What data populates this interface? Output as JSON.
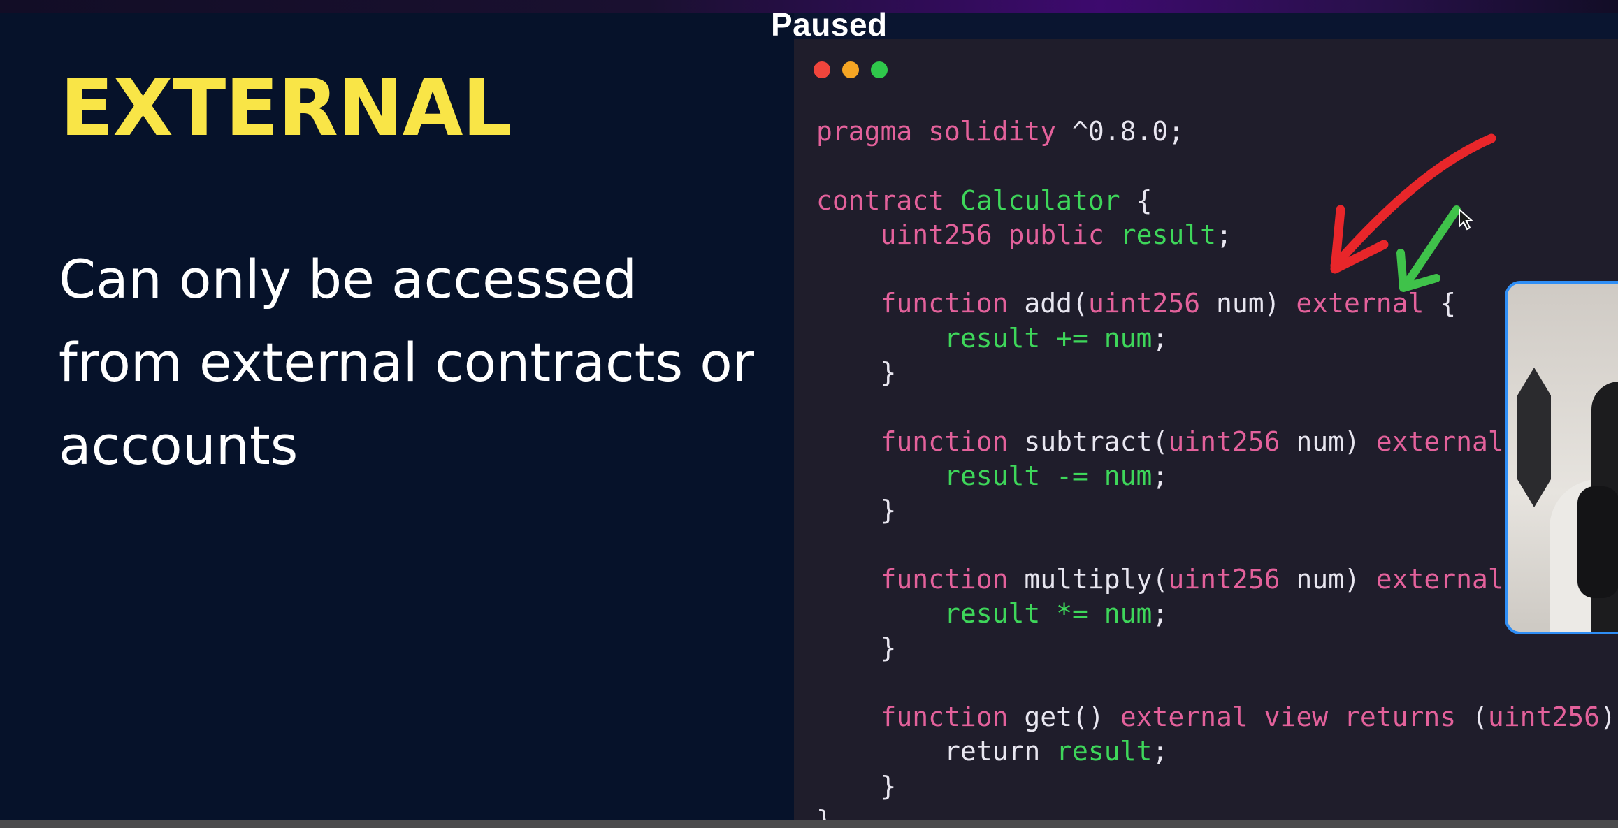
{
  "player": {
    "status": "Paused"
  },
  "slide": {
    "heading": "EXTERNAL",
    "description": "Can only be accessed from external contracts or accounts"
  },
  "code": {
    "lines": [
      [
        [
          "pragma solidity ",
          "kw"
        ],
        [
          "^0.8.0;",
          "pl"
        ]
      ],
      [],
      [
        [
          "contract ",
          "kw"
        ],
        [
          "Calculator",
          "gr"
        ],
        [
          " {",
          "pl"
        ]
      ],
      [
        [
          "    uint256 public ",
          "kw"
        ],
        [
          "result",
          "gr"
        ],
        [
          ";",
          "pl"
        ]
      ],
      [],
      [
        [
          "    function ",
          "kw"
        ],
        [
          "add(",
          "fn"
        ],
        [
          "uint256",
          "kw"
        ],
        [
          " num) ",
          "fn"
        ],
        [
          "external",
          "kw"
        ],
        [
          " {",
          "pl"
        ]
      ],
      [
        [
          "        result += num",
          "gr"
        ],
        [
          ";",
          "pl"
        ]
      ],
      [
        [
          "    }",
          "pl"
        ]
      ],
      [],
      [
        [
          "    function ",
          "kw"
        ],
        [
          "subtract(",
          "fn"
        ],
        [
          "uint256",
          "kw"
        ],
        [
          " num) ",
          "fn"
        ],
        [
          "external",
          "kw"
        ]
      ],
      [
        [
          "        result -= num",
          "gr"
        ],
        [
          ";",
          "pl"
        ]
      ],
      [
        [
          "    }",
          "pl"
        ]
      ],
      [],
      [
        [
          "    function ",
          "kw"
        ],
        [
          "multiply(",
          "fn"
        ],
        [
          "uint256",
          "kw"
        ],
        [
          " num) ",
          "fn"
        ],
        [
          "external",
          "kw"
        ]
      ],
      [
        [
          "        result *= num",
          "gr"
        ],
        [
          ";",
          "pl"
        ]
      ],
      [
        [
          "    }",
          "pl"
        ]
      ],
      [],
      [
        [
          "    function ",
          "kw"
        ],
        [
          "get() ",
          "fn"
        ],
        [
          "external view returns",
          "kw"
        ],
        [
          " (",
          "pl"
        ],
        [
          "uint256",
          "kw"
        ],
        [
          ")",
          "pl"
        ]
      ],
      [
        [
          "        return ",
          "pl"
        ],
        [
          "result",
          "gr"
        ],
        [
          ";",
          "pl"
        ]
      ],
      [
        [
          "    }",
          "pl"
        ]
      ],
      [
        [
          "}",
          "pl"
        ]
      ]
    ]
  },
  "colors": {
    "heading": "#f9e547",
    "keyword": "#e3619b",
    "identifier": "#3ed65a",
    "red_arrow": "#e8262a",
    "green_arrow": "#3fc24a",
    "webcam_border": "#2f8ef5"
  }
}
